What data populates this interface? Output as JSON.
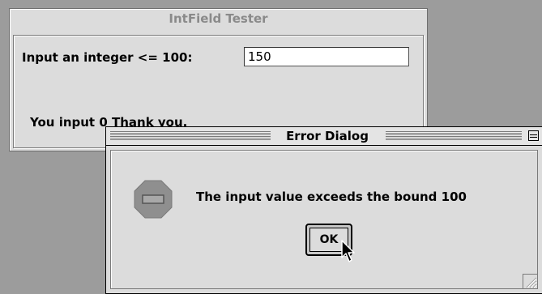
{
  "main_window": {
    "title": "IntField Tester",
    "input_label": "Input an integer <= 100:",
    "input_value": "150",
    "result_text": "You input 0 Thank you."
  },
  "dialog": {
    "title": "Error Dialog",
    "message": "The input value exceeds the bound 100",
    "ok_label": "OK",
    "icon": "stop-icon"
  },
  "colors": {
    "desktop": "#9c9c9c",
    "window": "#dcdcdc",
    "inactive_title": "#8a8a8a"
  }
}
